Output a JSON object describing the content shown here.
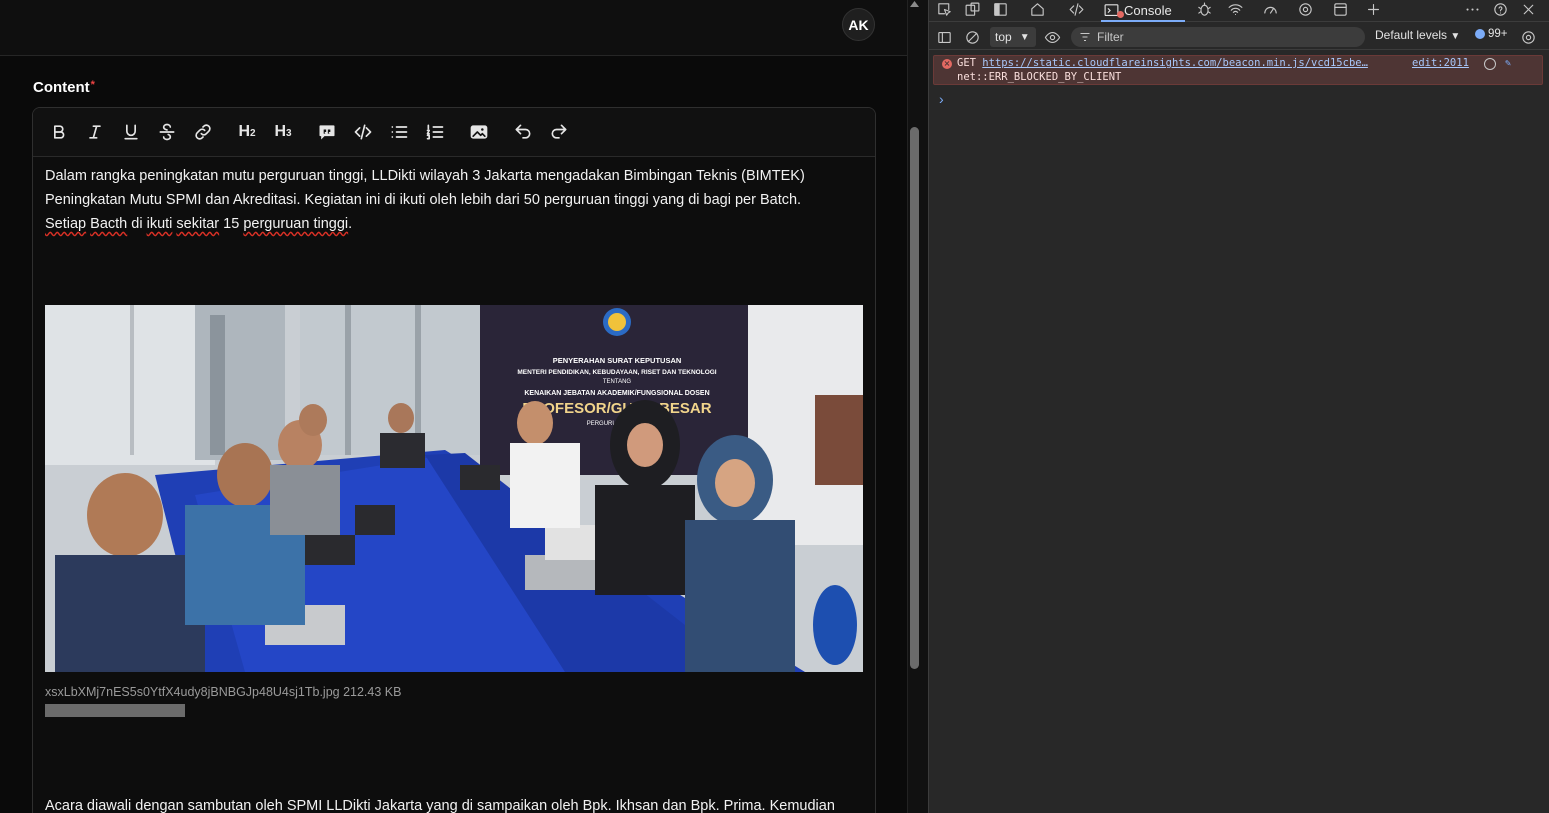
{
  "app": {
    "avatar_initials": "AK",
    "content_label": "Content",
    "required_mark": "*",
    "toolbar": {
      "h2": "H2",
      "h3": "H3"
    },
    "para1_a": "Dalam rangka peningkatan mutu perguruan tinggi, LLDikti wilayah 3 Jakarta mengadakan Bimbingan Teknis (BIMTEK) Peningkatan Mutu SPMI dan Akreditasi. Kegiatan ini di ikuti oleh lebih dari 50 perguruan tinggi yang di bagi per Batch. ",
    "para1_w1": "Setiap",
    "para1_w2": "Bacth",
    "para1_mid": " di ",
    "para1_w3": "ikuti",
    "para1_w4": "sekitar",
    "para1_mid2": " 15 ",
    "para1_w5": "perguruan tinggi",
    "para1_end": ".",
    "image_caption": "xsxLbXMj7nES5s0YtfX4udy8jBNBGJp48U4sj1Tb.jpg 212.43 KB",
    "banner": {
      "l1": "PENYERAHAN SURAT KEPUTUSAN",
      "l2": "MENTERI PENDIDIKAN, KEBUDAYAAN, RISET DAN TEKNOLOGI",
      "l3": "TENTANG",
      "l4": "KENAIKAN JEBATAN AKADEMIK/FUNGSIONAL DOSEN",
      "l5": "PROFESOR/GURU BESAR",
      "l6": "PERGURUAN TINGGI"
    },
    "para2": "Acara diawali dengan sambutan oleh SPMI LLDikti Jakarta yang di sampaikan oleh Bpk. Ikhsan dan Bpk. Prima. Kemudian"
  },
  "devtools": {
    "console_tab": "Console",
    "context": "top",
    "filter_placeholder": "Filter",
    "levels": "Default levels",
    "issues_count": "99+",
    "error": {
      "method": "GET",
      "url": "https://static.cloudflareinsights.com/beacon.min.js/vcd15cbe…",
      "message": "net::ERR_BLOCKED_BY_CLIENT",
      "source": "edit:2011"
    },
    "prompt": "›"
  }
}
